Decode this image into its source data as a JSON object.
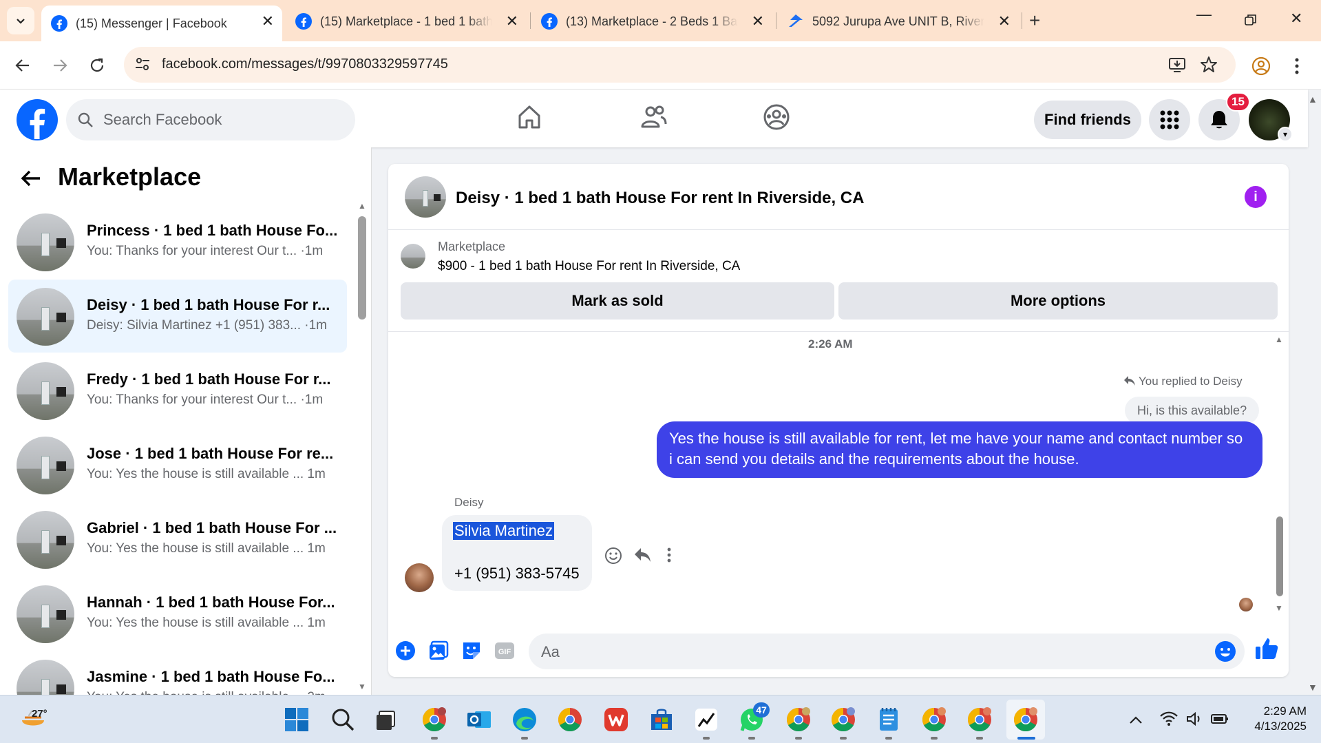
{
  "browser": {
    "tabs": [
      {
        "title": "(15) Messenger | Facebook",
        "active": true
      },
      {
        "title": "(15) Marketplace - 1 bed 1 bath",
        "active": false
      },
      {
        "title": "(13) Marketplace - 2 Beds 1 Bat",
        "active": false
      },
      {
        "title": "5092 Jurupa Ave UNIT B, Rivers",
        "active": false
      }
    ],
    "url": "facebook.com/messages/t/9970803329597745"
  },
  "fb": {
    "search_placeholder": "Search Facebook",
    "find_friends": "Find friends",
    "notifications_count": "15",
    "brand_color": "#0866ff"
  },
  "sidebar": {
    "title": "Marketplace",
    "conversations": [
      {
        "name": "Princess · 1 bed 1 bath House Fo...",
        "preview": "You: Thanks for your interest Our t... ·1m",
        "selected": false
      },
      {
        "name": "Deisy · 1 bed 1 bath House For r...",
        "preview": "Deisy: Silvia Martinez +1 (951) 383... ·1m",
        "selected": true
      },
      {
        "name": "Fredy · 1 bed 1 bath House For r...",
        "preview": "You: Thanks for your interest Our t... ·1m",
        "selected": false
      },
      {
        "name": "Jose · 1 bed 1 bath House For re...",
        "preview": "You: Yes the house is still available ...  1m",
        "selected": false
      },
      {
        "name": "Gabriel · 1 bed 1 bath House For ...",
        "preview": "You: Yes the house is still available ...  1m",
        "selected": false
      },
      {
        "name": "Hannah · 1 bed 1 bath House For...",
        "preview": "You: Yes the house is still available ...  1m",
        "selected": false
      },
      {
        "name": "Jasmine · 1 bed 1 bath House Fo...",
        "preview": "You: Yes the house is still available ...  2m",
        "selected": false
      }
    ]
  },
  "chat": {
    "title": "Deisy · 1 bed 1 bath House For rent In Riverside, CA",
    "listing_source": "Marketplace",
    "listing_title": "$900 - 1 bed 1 bath House For rent In Riverside, CA",
    "mark_sold": "Mark as sold",
    "more_options": "More options",
    "timestamp": "2:26 AM",
    "replied_label": "You replied to Deisy",
    "quoted_text": "Hi, is this available?",
    "outgoing_text": "Yes the house is still available for rent, let me have your name and  contact number so i can send you details and the requirements about the house.",
    "sender_name": "Deisy",
    "incoming_name": "Silvia Martinez",
    "incoming_phone": "+1 (951) 383-5745",
    "composer_placeholder": "Aa",
    "accent": "#3e42e8"
  },
  "taskbar": {
    "temperature": "27°",
    "whatsapp_badge": "47",
    "time": "2:29 AM",
    "date": "4/13/2025"
  }
}
